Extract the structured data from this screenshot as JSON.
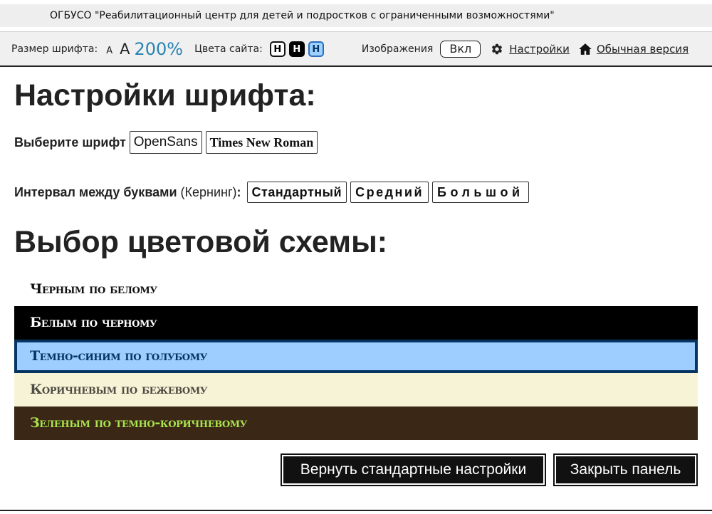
{
  "org_title": "ОГБУСО \"Реабилитационный центр для детей и подростков с ограниченными возможностями\"",
  "toolbar": {
    "font_size_label": "Размер шрифта:",
    "font_small": "A",
    "font_medium": "A",
    "font_large": "200%",
    "colors_label": "Цвета сайта:",
    "color_white": "Н",
    "color_black": "Н",
    "color_blue": "Н",
    "images_label": "Изображения",
    "images_toggle": "Вкл",
    "settings_link": "Настройки",
    "normal_version_link": "Обычная версия",
    "icons": {
      "settings": "gear-icon",
      "home": "home-icon"
    }
  },
  "font_settings": {
    "heading": "Настройки шрифта:",
    "choose_label": "Выберите шрифт",
    "fonts": [
      "OpenSans",
      "Times New Roman"
    ]
  },
  "kerning": {
    "label": "Интервал между буквами",
    "label_paren": "(Кернинг)",
    "colon": ":",
    "options": [
      "Стандартный",
      "Средний",
      "Большой"
    ]
  },
  "color_scheme": {
    "heading": "Выбор цветовой схемы:",
    "options": [
      {
        "label": "Черным по белому",
        "fg": "#111111",
        "bg": "#ffffff"
      },
      {
        "label": "Белым по черному",
        "fg": "#ffffff",
        "bg": "#000000"
      },
      {
        "label": "Темно-синим по голубому",
        "fg": "#063462",
        "bg": "#9dceff"
      },
      {
        "label": "Коричневым по бежевому",
        "fg": "#4d4b43",
        "bg": "#f7f3d6"
      },
      {
        "label": "Зеленым по темно-коричневому",
        "fg": "#a9e44d",
        "bg": "#3b2716"
      }
    ]
  },
  "actions": {
    "reset": "Вернуть стандартные настройки",
    "close": "Закрыть панель"
  }
}
